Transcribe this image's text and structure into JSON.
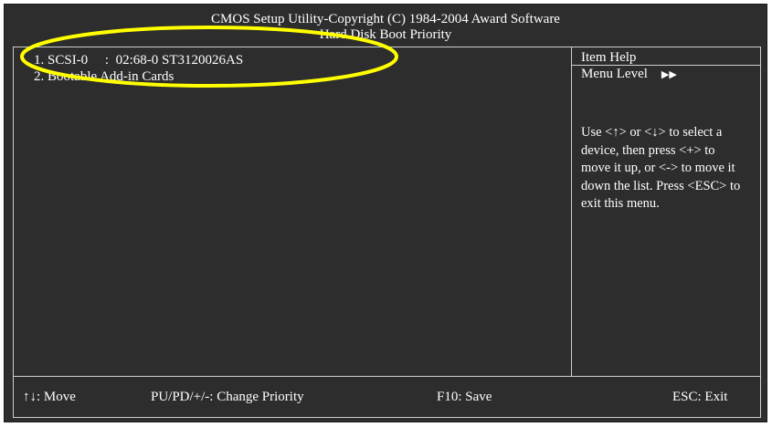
{
  "header": {
    "line1": "CMOS Setup Utility-Copyright (C) 1984-2004 Award Software",
    "line2": "Hard Disk Boot Priority"
  },
  "boot_list": {
    "items": [
      {
        "label": "1. SCSI-0     :  02:68-0 ST3120026AS"
      },
      {
        "label": "2. Bootable Add-in Cards"
      }
    ]
  },
  "help": {
    "title": "Item Help",
    "menu_level_label": "Menu Level",
    "menu_level_arrows": "▶▶",
    "text": "Use <↑> or <↓> to select a device, then press <+> to move it up, or <-> to move it down the list. Press <ESC> to exit this menu."
  },
  "footer": {
    "move": "↑↓: Move",
    "change_priority": "PU/PD/+/-: Change Priority",
    "save": "F10: Save",
    "exit": "ESC: Exit"
  },
  "colors": {
    "background": "#2d2d2d",
    "text": "#ffffff",
    "highlight": "#ffff00"
  }
}
